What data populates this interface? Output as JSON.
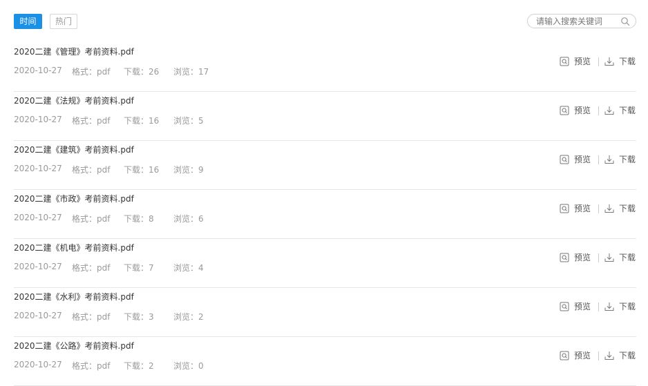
{
  "tabs": [
    {
      "label": "时间",
      "active": true
    },
    {
      "label": "热门",
      "active": false
    }
  ],
  "search": {
    "placeholder": "请输入搜索关键词",
    "icon": "search-icon"
  },
  "labels": {
    "format_prefix": "格式：",
    "downloads_prefix": "下载：",
    "views_prefix": "浏览：",
    "preview": "预览",
    "download": "下载"
  },
  "colors": {
    "accent": "#1b91e6",
    "meta_text": "#999999",
    "divider": "#e6e6e6"
  },
  "files": [
    {
      "title": "2020二建《管理》考前资料.pdf",
      "date": "2020-10-27",
      "format": "pdf",
      "downloads": "26",
      "views": "17"
    },
    {
      "title": "2020二建《法规》考前资料.pdf",
      "date": "2020-10-27",
      "format": "pdf",
      "downloads": "16",
      "views": "5"
    },
    {
      "title": "2020二建《建筑》考前资料.pdf",
      "date": "2020-10-27",
      "format": "pdf",
      "downloads": "16",
      "views": "9"
    },
    {
      "title": "2020二建《市政》考前资料.pdf",
      "date": "2020-10-27",
      "format": "pdf",
      "downloads": "8",
      "views": "6"
    },
    {
      "title": "2020二建《机电》考前资料.pdf",
      "date": "2020-10-27",
      "format": "pdf",
      "downloads": "7",
      "views": "4"
    },
    {
      "title": "2020二建《水利》考前资料.pdf",
      "date": "2020-10-27",
      "format": "pdf",
      "downloads": "3",
      "views": "2"
    },
    {
      "title": "2020二建《公路》考前资料.pdf",
      "date": "2020-10-27",
      "format": "pdf",
      "downloads": "2",
      "views": "0"
    }
  ]
}
